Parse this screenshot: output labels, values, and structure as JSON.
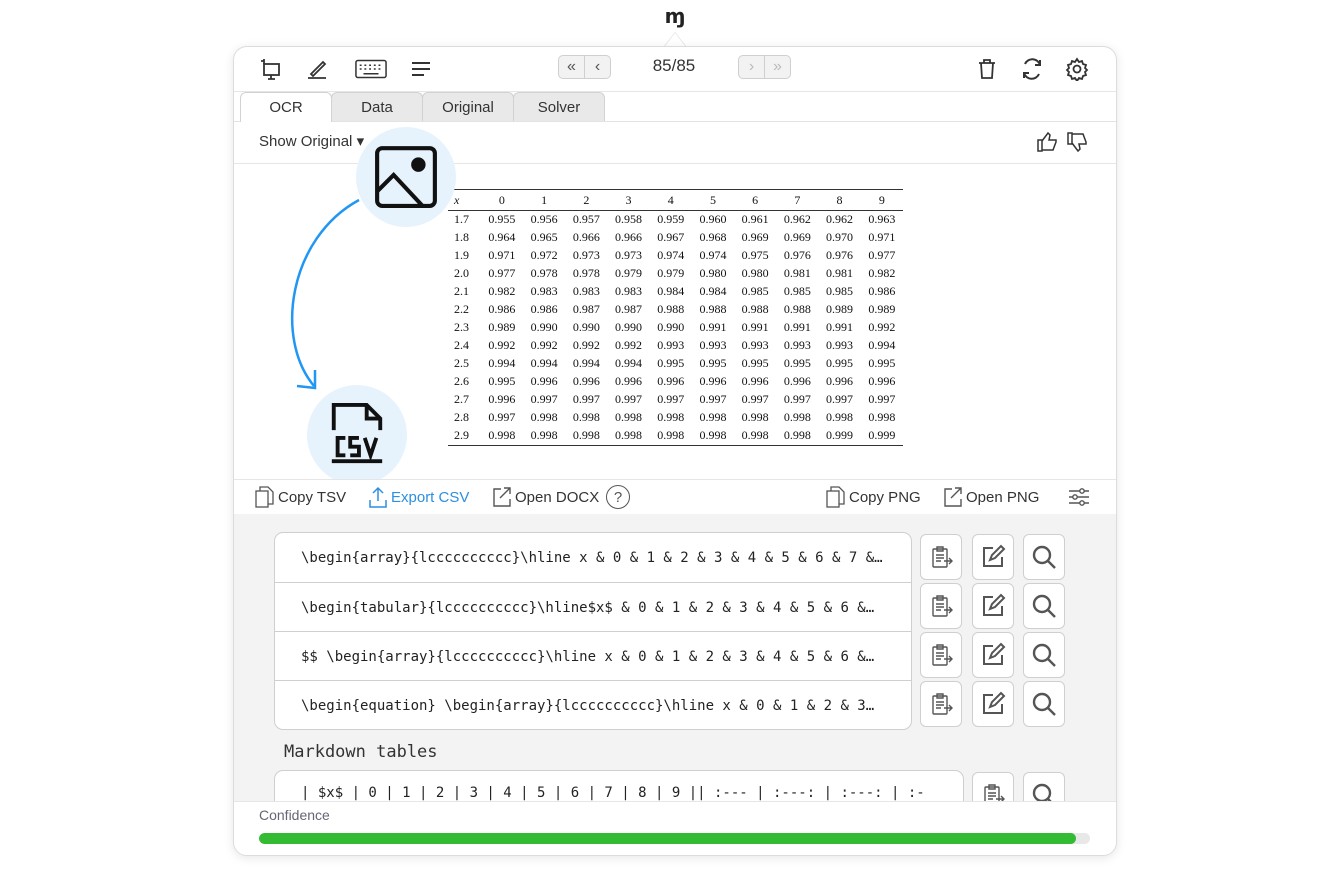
{
  "app": {
    "logo_text": "ɱ"
  },
  "toolbar": {
    "page_counter": "85/85",
    "icons": [
      "screenshot-icon",
      "handwriting-icon",
      "keyboard-icon",
      "text-lines-icon",
      "trash-icon",
      "refresh-icon",
      "gear-icon"
    ]
  },
  "tabs": [
    {
      "label": "OCR",
      "active": true
    },
    {
      "label": "Data",
      "active": false
    },
    {
      "label": "Original",
      "active": false
    },
    {
      "label": "Solver",
      "active": false
    }
  ],
  "show_bar": {
    "label": "Show Original",
    "chevron": "▾"
  },
  "math_table": {
    "header": [
      "x",
      "0",
      "1",
      "2",
      "3",
      "4",
      "5",
      "6",
      "7",
      "8",
      "9"
    ],
    "rows": [
      [
        "1.7",
        "0.955",
        "0.956",
        "0.957",
        "0.958",
        "0.959",
        "0.960",
        "0.961",
        "0.962",
        "0.962",
        "0.963"
      ],
      [
        "1.8",
        "0.964",
        "0.965",
        "0.966",
        "0.966",
        "0.967",
        "0.968",
        "0.969",
        "0.969",
        "0.970",
        "0.971"
      ],
      [
        "1.9",
        "0.971",
        "0.972",
        "0.973",
        "0.973",
        "0.974",
        "0.974",
        "0.975",
        "0.976",
        "0.976",
        "0.977"
      ],
      [
        "2.0",
        "0.977",
        "0.978",
        "0.978",
        "0.979",
        "0.979",
        "0.980",
        "0.980",
        "0.981",
        "0.981",
        "0.982"
      ],
      [
        "2.1",
        "0.982",
        "0.983",
        "0.983",
        "0.983",
        "0.984",
        "0.984",
        "0.985",
        "0.985",
        "0.985",
        "0.986"
      ],
      [
        "2.2",
        "0.986",
        "0.986",
        "0.987",
        "0.987",
        "0.988",
        "0.988",
        "0.988",
        "0.988",
        "0.989",
        "0.989"
      ],
      [
        "2.3",
        "0.989",
        "0.990",
        "0.990",
        "0.990",
        "0.990",
        "0.991",
        "0.991",
        "0.991",
        "0.991",
        "0.992"
      ],
      [
        "2.4",
        "0.992",
        "0.992",
        "0.992",
        "0.992",
        "0.993",
        "0.993",
        "0.993",
        "0.993",
        "0.993",
        "0.994"
      ],
      [
        "2.5",
        "0.994",
        "0.994",
        "0.994",
        "0.994",
        "0.995",
        "0.995",
        "0.995",
        "0.995",
        "0.995",
        "0.995"
      ],
      [
        "2.6",
        "0.995",
        "0.996",
        "0.996",
        "0.996",
        "0.996",
        "0.996",
        "0.996",
        "0.996",
        "0.996",
        "0.996"
      ],
      [
        "2.7",
        "0.996",
        "0.997",
        "0.997",
        "0.997",
        "0.997",
        "0.997",
        "0.997",
        "0.997",
        "0.997",
        "0.997"
      ],
      [
        "2.8",
        "0.997",
        "0.998",
        "0.998",
        "0.998",
        "0.998",
        "0.998",
        "0.998",
        "0.998",
        "0.998",
        "0.998"
      ],
      [
        "2.9",
        "0.998",
        "0.998",
        "0.998",
        "0.998",
        "0.998",
        "0.998",
        "0.998",
        "0.998",
        "0.999",
        "0.999"
      ]
    ]
  },
  "actions": {
    "copy_tsv": "Copy TSV",
    "export_csv": "Export CSV",
    "open_docx": "Open DOCX",
    "help": "?",
    "copy_png": "Copy PNG",
    "open_png": "Open PNG"
  },
  "results": [
    "\\begin{array}{lcccccccccc}\\hline x & 0 & 1 & 2 & 3 & 4 & 5 & 6 & 7 &…",
    "\\begin{tabular}{lcccccccccc}\\hline$x$ & 0 & 1 & 2 & 3 & 4 & 5 & 6 &…",
    "$$ \\begin{array}{lcccccccccc}\\hline x & 0 & 1 & 2 & 3 & 4 & 5 & 6 &…",
    "\\begin{equation} \\begin{array}{lcccccccccc}\\hline x & 0 & 1 & 2 & 3…"
  ],
  "markdown": {
    "label": "Markdown tables",
    "row": "| $x$ | 0 | 1 | 2 | 3 | 4 | 5 | 6 | 7 | 8 | 9 || :--- | :---: | :---: | :-"
  },
  "confidence": {
    "label": "Confidence",
    "value": 0.983
  },
  "colors": {
    "accent": "#2c8fe0",
    "confidence": "#33bb33",
    "badge_bg": "#e7f3fc"
  }
}
